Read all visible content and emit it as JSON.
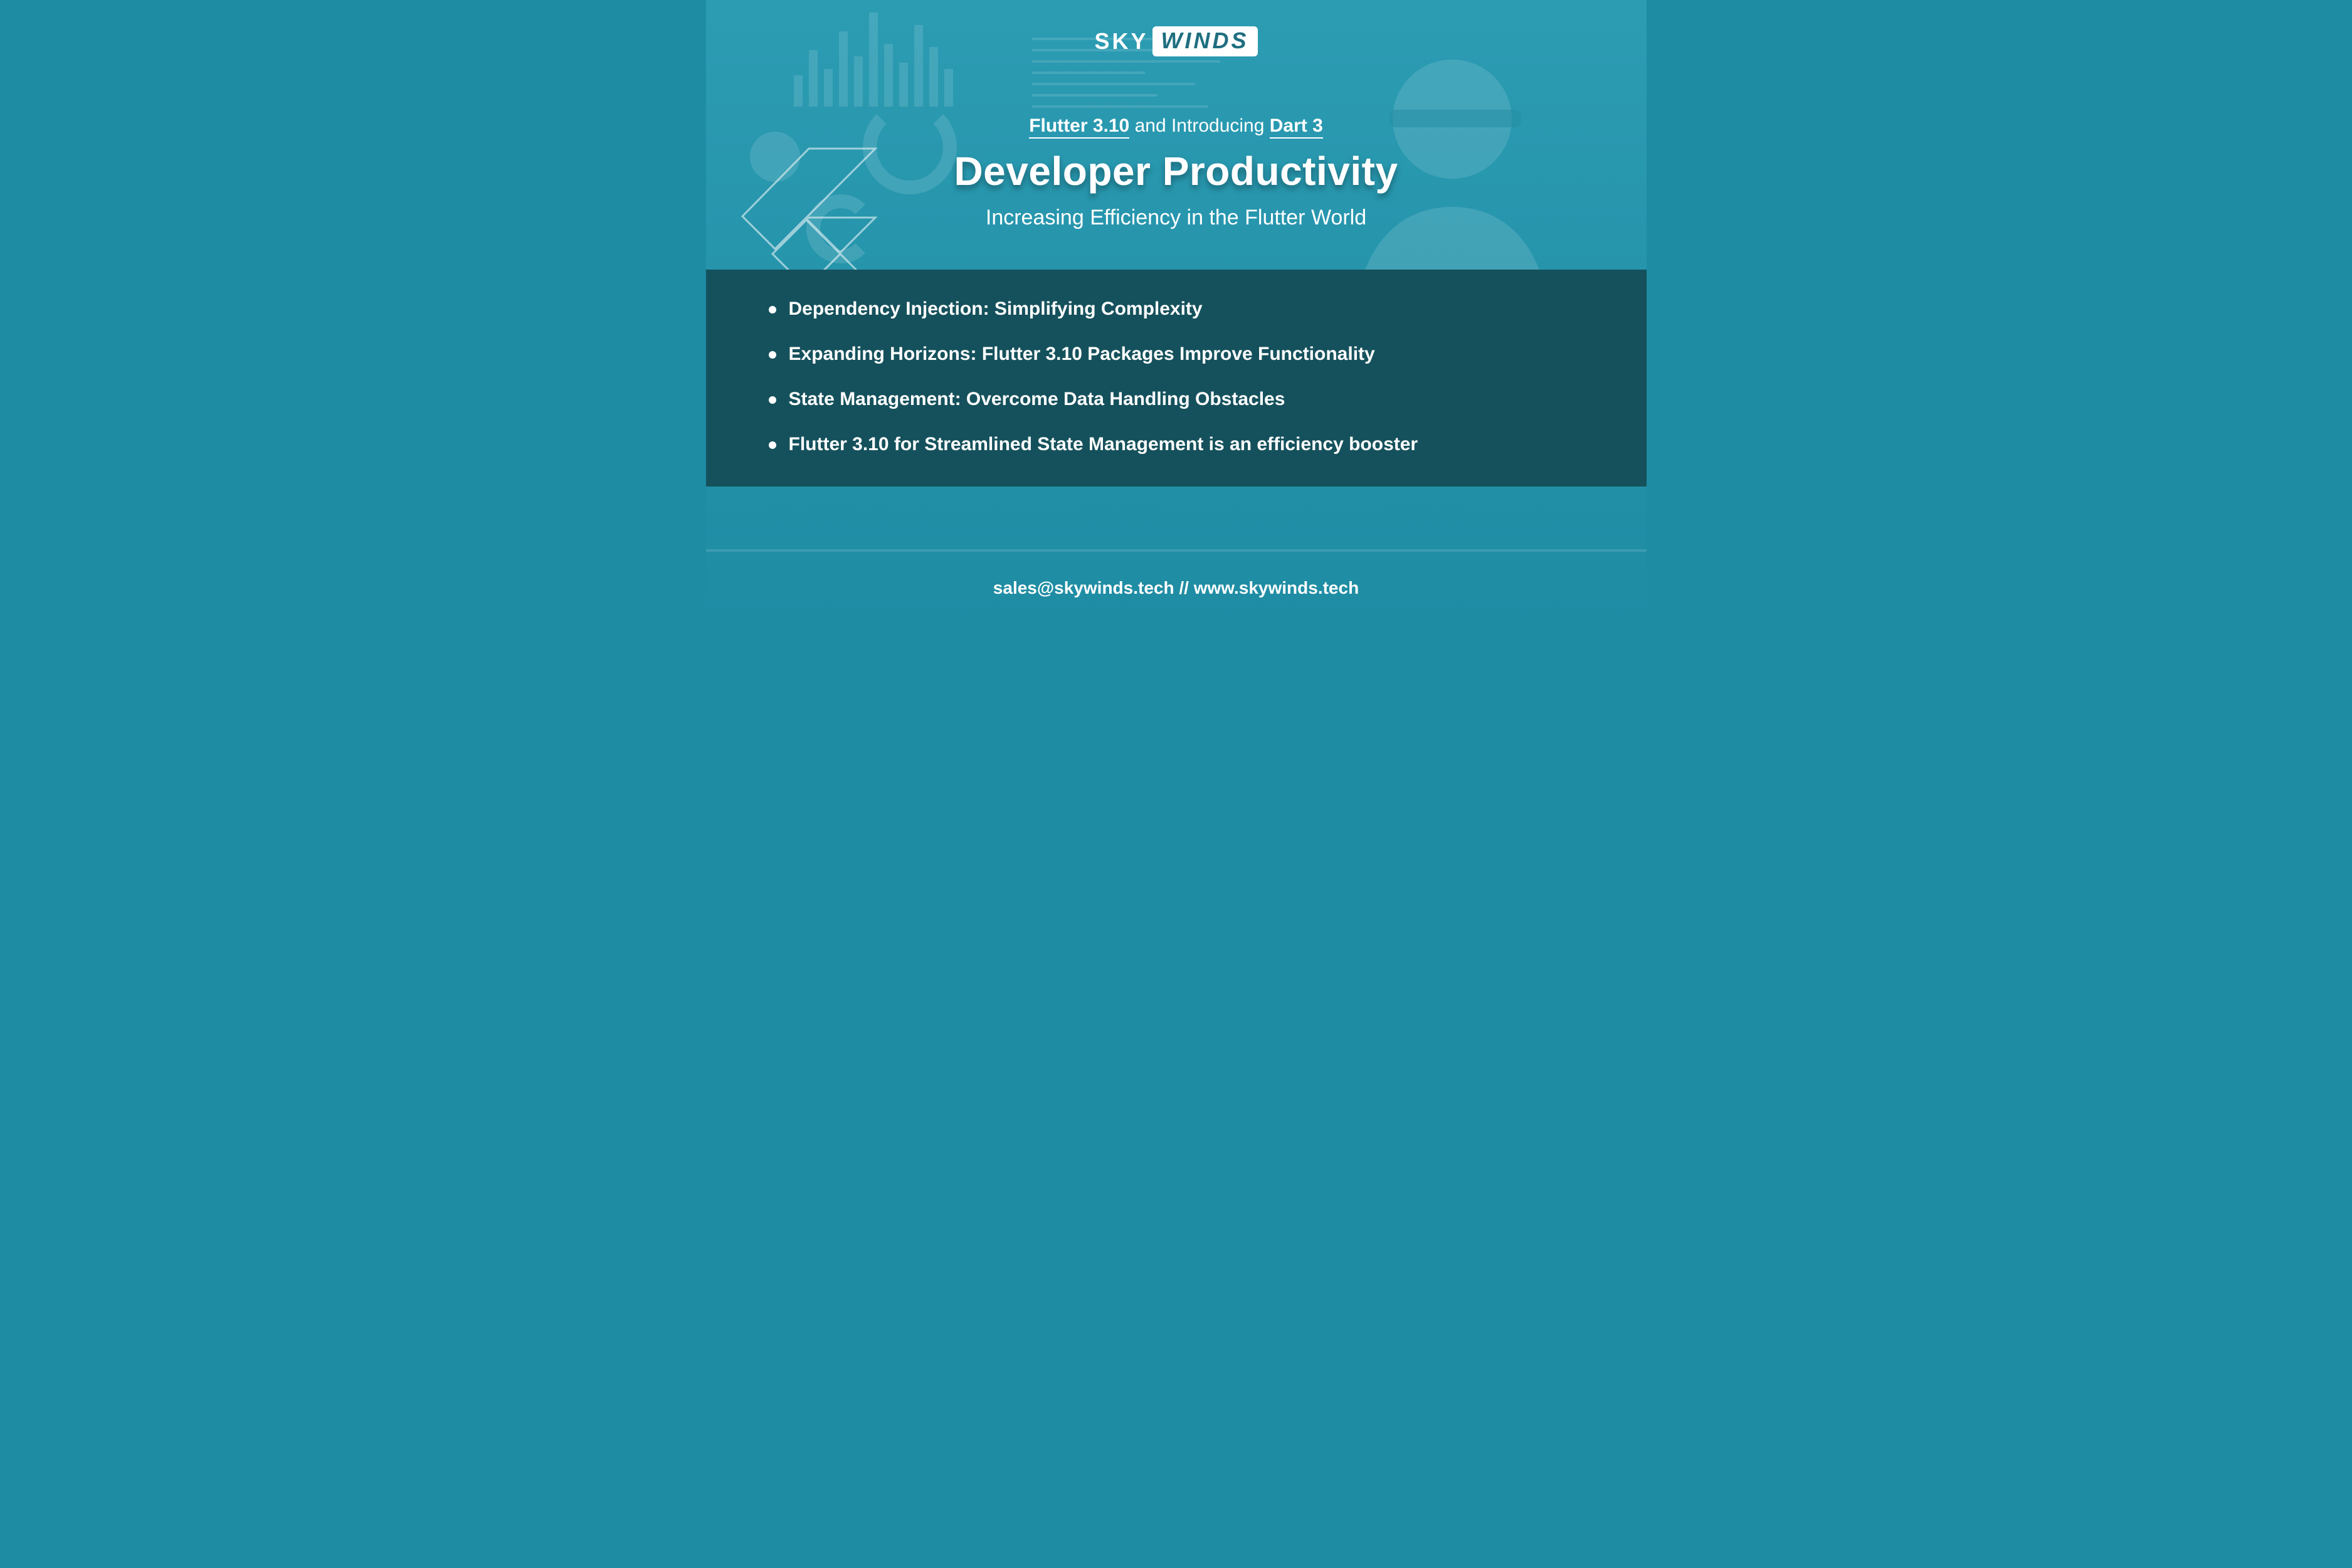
{
  "brand": {
    "part1": "SKY",
    "part2": "WINDS"
  },
  "header": {
    "kicker_link1": "Flutter 3.10",
    "kicker_middle": " and Introducing ",
    "kicker_link2": "Dart 3",
    "title": "Developer Productivity",
    "subtitle": "Increasing Efficiency in the Flutter World"
  },
  "bullets": [
    "Dependency Injection: Simplifying Complexity",
    "Expanding Horizons: Flutter 3.10 Packages Improve Functionality",
    "State Management: Overcome Data Handling Obstacles",
    "Flutter 3.10 for Streamlined State Management is an efficiency booster"
  ],
  "footer": {
    "contact": "sales@skywinds.tech // www.skywinds.tech"
  },
  "colors": {
    "bg_top": "#2c9cb3",
    "bg_bottom": "#1e8ca3",
    "panel": "#15515c",
    "text": "#ffffff"
  }
}
